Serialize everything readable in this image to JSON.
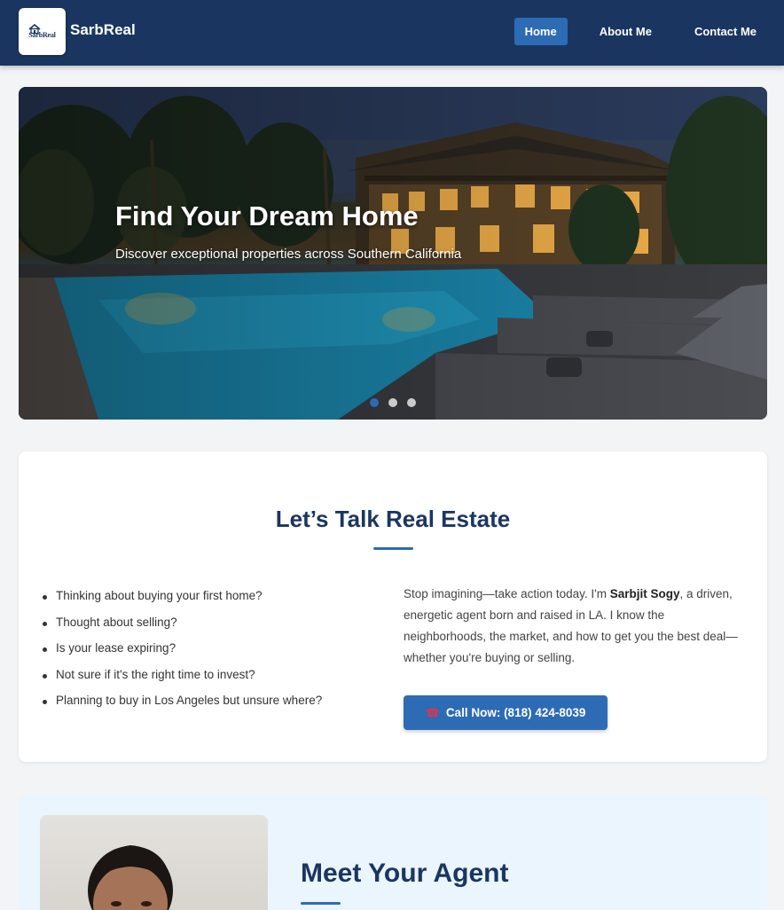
{
  "header": {
    "logo_text": "SarbReal",
    "brand": "SarbReal",
    "nav": [
      {
        "label": "Home",
        "active": true
      },
      {
        "label": "About Me",
        "active": false
      },
      {
        "label": "Contact Me",
        "active": false
      }
    ]
  },
  "hero": {
    "title": "Find Your Dream Home",
    "subtitle": "Discover exceptional properties across Southern California",
    "slides": 3,
    "active_slide": 1
  },
  "talk": {
    "title": "Let’s Talk Real Estate",
    "questions": [
      "Thinking about buying your first home?",
      "Thought about selling?",
      "Is your lease expiring?",
      "Not sure if it's the right time to invest?",
      "Planning to buy in Los Angeles but unsure where?"
    ],
    "intro_before": "Stop imagining—take action today. I'm ",
    "intro_name": "Sarbjit Sogy",
    "intro_after": ", a driven, energetic agent born and raised in LA. I know the neighborhoods, the market, and how to get you the best deal—whether you're buying or selling.",
    "call_label": "Call Now: (818) 424-8039",
    "call_icon": "phone-icon"
  },
  "agent": {
    "title": "Meet Your Agent"
  },
  "colors": {
    "header_bg": "#1a3660",
    "accent": "#2d6bb5",
    "heading": "#1a3660",
    "agent_bg": "#eaf5fd"
  }
}
